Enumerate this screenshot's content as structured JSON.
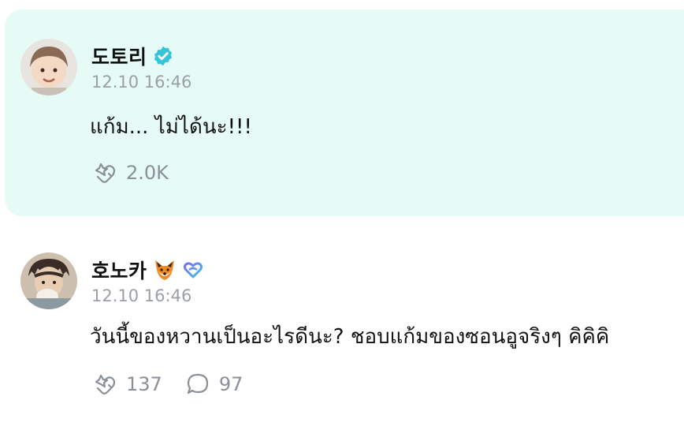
{
  "posts": [
    {
      "author": "도토리",
      "verified": true,
      "timestamp": "12.10 16:46",
      "text": "แก้ม... ไม่ได้นะ!!!",
      "likes": "2.0K",
      "comments": null
    },
    {
      "author": "호노카",
      "author_emoji": "fox-emoji",
      "badge": "heart-badge",
      "timestamp": "12.10 16:46",
      "text": "วันนี้ของหวานเป็นอะไรดีนะ? ชอบแก้มของซอนอูจริงๆ คิคิคิ",
      "likes": "137",
      "comments": "97"
    }
  ],
  "colors": {
    "highlight_bg": "#e6fbf6",
    "verified": "#35c4d8",
    "muted": "#9aa0a6"
  }
}
